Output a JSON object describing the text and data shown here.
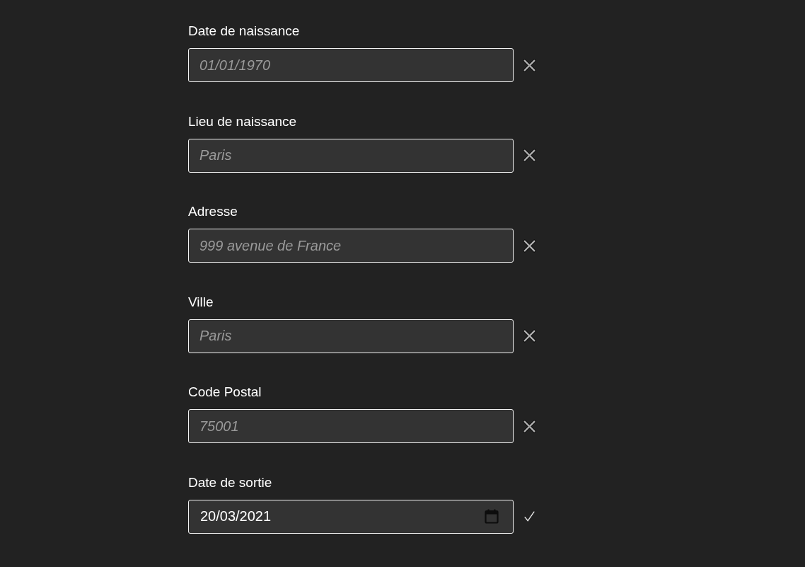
{
  "fields": [
    {
      "label": "Date de naissance",
      "kind": "text",
      "placeholder": "01/01/1970",
      "valid": false
    },
    {
      "label": "Lieu de naissance",
      "kind": "text",
      "placeholder": "Paris",
      "valid": false
    },
    {
      "label": "Adresse",
      "kind": "text",
      "placeholder": "999 avenue de France",
      "valid": false
    },
    {
      "label": "Ville",
      "kind": "text",
      "placeholder": "Paris",
      "valid": false
    },
    {
      "label": "Code Postal",
      "kind": "text",
      "placeholder": "75001",
      "valid": false
    },
    {
      "label": "Date de sortie",
      "kind": "date",
      "value": "20/03/2021",
      "valid": true
    }
  ]
}
